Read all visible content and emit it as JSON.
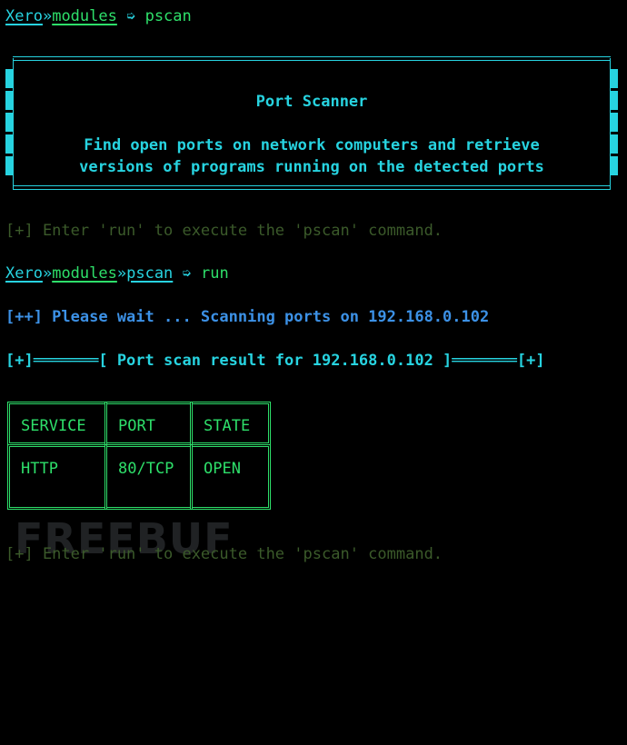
{
  "prompt1": {
    "brand": "Xero",
    "sep": "»",
    "path": "modules",
    "arrow": " ➭ ",
    "command": "pscan"
  },
  "banner": {
    "title": "Port Scanner",
    "desc_line1": "Find open ports on network computers and retrieve",
    "desc_line2": "versions of programs running on the detected ports"
  },
  "hint1": "[+] Enter 'run' to execute the 'pscan' command.",
  "prompt2": {
    "brand": "Xero",
    "sep1": "»",
    "path": "modules",
    "sep2": "»",
    "module": "pscan",
    "arrow": " ➭ ",
    "command": "run"
  },
  "scan_status": "[++] Please wait ... Scanning ports on 192.168.0.102",
  "result_header": "[+]═══════[ Port scan result for 192.168.0.102 ]═══════[+]",
  "table": {
    "headers": [
      "SERVICE",
      "PORT",
      "STATE"
    ],
    "rows": [
      [
        "HTTP",
        "80/TCP",
        "OPEN"
      ]
    ]
  },
  "hint2": "[+] Enter 'run' to execute the 'pscan' command.",
  "watermark": "FREEBUF",
  "colors": {
    "cyan": "#27d3e0",
    "green": "#2edf6a",
    "blue": "#3c91e6",
    "dim": "#3b5a2a"
  }
}
